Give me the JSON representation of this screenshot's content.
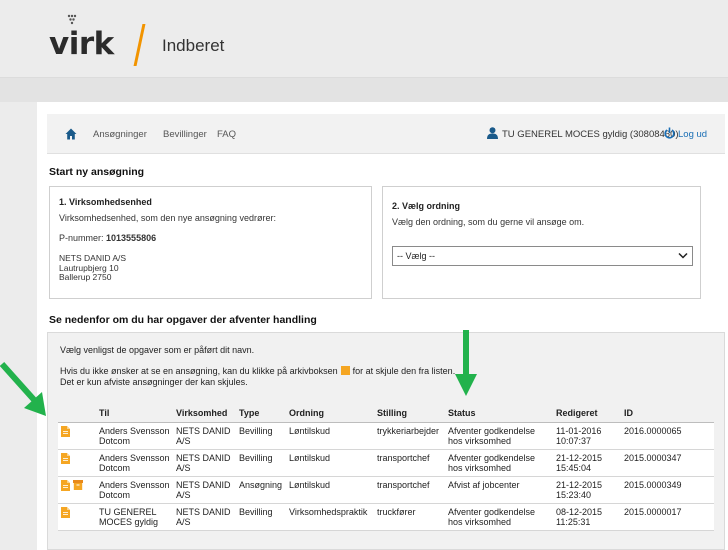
{
  "header": {
    "logo_text": "virk",
    "title": "Indberet"
  },
  "nav": {
    "home_icon": "home-icon",
    "links": [
      "Ansøgninger",
      "Bevillinger",
      "FAQ"
    ],
    "user": "TU GENEREL MOCES gyldig (30808460)",
    "logout": "Log ud"
  },
  "start": {
    "heading": "Start ny ansøgning",
    "box1": {
      "title": "1. Virksomhedsenhed",
      "description": "Virksomhedsenhed, som den nye ansøgning vedrører:",
      "pnummer_label": "P-nummer:",
      "pnummer_value": "1013555806",
      "address": [
        "NETS DANID A/S",
        "Lautrupbjerg 10",
        "Ballerup 2750"
      ]
    },
    "box2": {
      "title": "2. Vælg ordning",
      "description": "Vælg den ordning, som du gerne vil ansøge om.",
      "select_value": "-- Vælg --"
    }
  },
  "tasks": {
    "heading": "Se nedenfor om du har opgaver der afventer handling",
    "instruction": "Vælg venligst de opgaver som er påført dit navn.",
    "hint_part1": "Hvis du ikke ønsker at se en ansøgning, kan du klikke på arkivboksen",
    "hint_part2": "for at skjule den fra listen.",
    "hint_line2": "Det er kun afviste ansøgninger der kan skjules.",
    "columns": [
      "Til",
      "Virksomhed",
      "Type",
      "Ordning",
      "Stilling",
      "Status",
      "Redigeret",
      "ID"
    ],
    "rows": [
      {
        "archive": false,
        "til": "Anders Svensson Dotcom",
        "virksomhed": "NETS DANID A/S",
        "type": "Bevilling",
        "ordning": "Løntilskud",
        "stilling": "trykkeriarbejder",
        "status": "Afventer godkendelse hos virksomhed",
        "redigeret_date": "11-01-2016",
        "redigeret_time": "10:07:37",
        "id": "2016.0000065"
      },
      {
        "archive": false,
        "til": "Anders Svensson Dotcom",
        "virksomhed": "NETS DANID A/S",
        "type": "Bevilling",
        "ordning": "Løntilskud",
        "stilling": "transportchef",
        "status": "Afventer godkendelse hos virksomhed",
        "redigeret_date": "21-12-2015",
        "redigeret_time": "15:45:04",
        "id": "2015.0000347"
      },
      {
        "archive": true,
        "til": "Anders Svensson Dotcom",
        "virksomhed": "NETS DANID A/S",
        "type": "Ansøgning",
        "ordning": "Løntilskud",
        "stilling": "transportchef",
        "status": "Afvist af jobcenter",
        "redigeret_date": "21-12-2015",
        "redigeret_time": "15:23:40",
        "id": "2015.0000349"
      },
      {
        "archive": false,
        "til": "TU GENEREL MOCES gyldig",
        "virksomhed": "NETS DANID A/S",
        "type": "Bevilling",
        "ordning": "Virksomhedspraktik",
        "stilling": "truckfører",
        "status": "Afventer godkendelse hos virksomhed",
        "redigeret_date": "08-12-2015",
        "redigeret_time": "11:25:31",
        "id": "2015.0000017"
      }
    ]
  },
  "colors": {
    "accent_orange": "#f29400",
    "doc_icon": "#f5a623",
    "link_blue": "#1a6fb5",
    "arrow_green": "#22b24c"
  }
}
